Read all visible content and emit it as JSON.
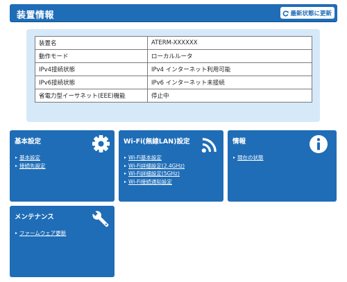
{
  "header": {
    "title": "装置情報",
    "refresh_label": "最新状態に更新"
  },
  "device_info": {
    "rows": [
      {
        "key": "装置名",
        "value": "ATERM-XXXXXX"
      },
      {
        "key": "動作モード",
        "value": "ローカルルータ"
      },
      {
        "key": "IPv4接続状態",
        "value": "IPv4 インターネット利用可能"
      },
      {
        "key": "IPv6接続状態",
        "value": "IPv6 インターネット未接続"
      },
      {
        "key": "省電力型イーサネット(EEE)機能",
        "value": "停止中"
      }
    ]
  },
  "cards": {
    "basic": {
      "title": "基本設定",
      "icon": "gear-icon",
      "links": [
        "基本設定",
        "接続先設定"
      ]
    },
    "wifi": {
      "title": "Wi-Fi(無線LAN)設定",
      "icon": "wifi-icon",
      "links": [
        "Wi-Fi基本設定",
        "Wi-Fi詳細設定(2.4GHz)",
        "Wi-Fi詳細設定(5GHz)",
        "Wi-Fi接続通知設定"
      ]
    },
    "info": {
      "title": "情報",
      "icon": "info-icon",
      "links": [
        "現在の状態"
      ]
    },
    "maintenance": {
      "title": "メンテナンス",
      "icon": "wrench-icon",
      "links": [
        "ファームウェア更新"
      ]
    }
  },
  "colors": {
    "primary": "#1f6db7",
    "panel_bg": "#d6e9f9"
  }
}
